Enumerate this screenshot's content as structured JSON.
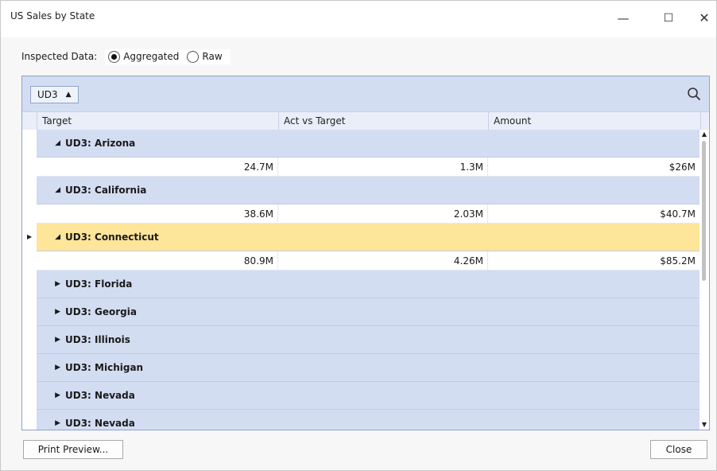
{
  "window": {
    "title": "US Sales by State",
    "minimize_glyph": "—",
    "maximize_glyph": "☐",
    "close_glyph": "✕"
  },
  "inspect": {
    "label": "Inspected Data:",
    "options": [
      {
        "label": "Aggregated",
        "checked": true
      },
      {
        "label": "Raw",
        "checked": false
      }
    ]
  },
  "grid": {
    "group_chip": "UD3",
    "columns": [
      "Target",
      "Act vs Target",
      "Amount"
    ],
    "groups": [
      {
        "label": "UD3: Arizona",
        "expanded": true,
        "selected": false,
        "values": [
          "24.7M",
          "1.3M",
          "$26M"
        ]
      },
      {
        "label": "UD3: California",
        "expanded": true,
        "selected": false,
        "values": [
          "38.6M",
          "2.03M",
          "$40.7M"
        ]
      },
      {
        "label": "UD3: Connecticut",
        "expanded": true,
        "selected": true,
        "values": [
          "80.9M",
          "4.26M",
          "$85.2M"
        ]
      },
      {
        "label": "UD3: Florida",
        "expanded": false,
        "selected": false
      },
      {
        "label": "UD3: Georgia",
        "expanded": false,
        "selected": false
      },
      {
        "label": "UD3: Illinois",
        "expanded": false,
        "selected": false
      },
      {
        "label": "UD3: Michigan",
        "expanded": false,
        "selected": false
      },
      {
        "label": "UD3: Nevada",
        "expanded": false,
        "selected": false
      },
      {
        "label": "UD3: Nevada",
        "expanded": false,
        "selected": false
      }
    ]
  },
  "footer": {
    "print_label": "Print Preview...",
    "close_label": "Close"
  },
  "colors": {
    "group_bg": "#d3ddf2",
    "selected_bg": "#fde59a"
  },
  "icons": {
    "search": "search-icon",
    "expanded": "triangle-down-icon",
    "collapsed": "triangle-right-icon"
  }
}
